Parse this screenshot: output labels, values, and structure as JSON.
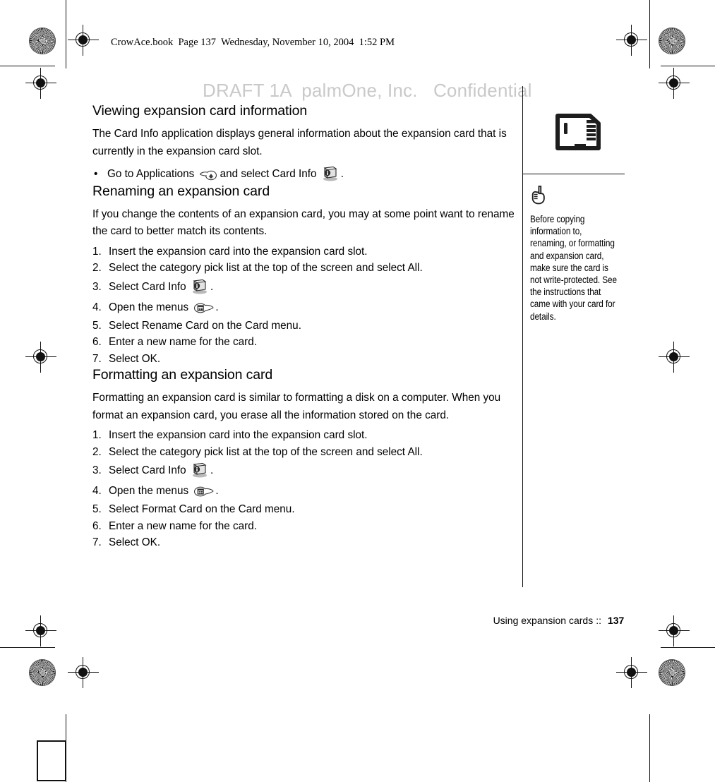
{
  "print_marks": {
    "file_header": "CrowAce.book  Page 137  Wednesday, November 10, 2004  1:52 PM",
    "watermark": "DRAFT 1A  palmOne, Inc.   Confidential"
  },
  "content": {
    "sections": [
      {
        "heading": "Viewing expansion card information",
        "paragraphs": [
          "The Card Info application displays general information about the expansion card that is currently in the expansion card slot."
        ],
        "bullets": [
          {
            "pre": "Go to Applications",
            "icon1": "applications-icon",
            "mid": "and select Card Info",
            "icon2": "card-info-icon",
            "post": "."
          }
        ]
      },
      {
        "heading": "Renaming an expansion card",
        "paragraphs": [
          "If you change the contents of an expansion card, you may at some point want to rename the card to better match its contents."
        ],
        "steps": [
          {
            "text": "Insert the expansion card into the expansion card slot."
          },
          {
            "text": "Select the category pick list at the top of the screen and select All."
          },
          {
            "pre": "Select Card Info",
            "icon": "card-info-icon",
            "post": "."
          },
          {
            "pre": "Open the menus",
            "icon": "menus-icon",
            "post": "."
          },
          {
            "text": "Select Rename Card on the Card menu."
          },
          {
            "text": "Enter a new name for the card."
          },
          {
            "text": "Select OK."
          }
        ]
      },
      {
        "heading": "Formatting an expansion card",
        "paragraphs": [
          "Formatting an expansion card is similar to formatting a disk on a computer. When you format an expansion card, you erase all the information stored on the card."
        ],
        "steps": [
          {
            "text": "Insert the expansion card into the expansion card slot."
          },
          {
            "text": "Select the category pick list at the top of the screen and select All."
          },
          {
            "pre": "Select Card Info",
            "icon": "card-info-icon",
            "post": "."
          },
          {
            "pre": "Open the menus",
            "icon": "menus-icon",
            "post": "."
          },
          {
            "text": "Select Format Card on the Card menu."
          },
          {
            "text": "Enter a new name for the card."
          },
          {
            "text": "Select OK."
          }
        ]
      }
    ]
  },
  "sidebar": {
    "card_icon": "sd-card-icon",
    "tip_icon": "pointing-hand-icon",
    "tip_text": "Before copying information to, renaming, or formatting and expansion card, make sure the card is not write-protected. See the instructions that came with your card for details."
  },
  "footer": {
    "chapter": "Using expansion cards",
    "separator": "::",
    "page_number": "137"
  },
  "colors": {
    "text": "#000000",
    "watermark": "#c9c9c9",
    "rule": "#111111"
  }
}
